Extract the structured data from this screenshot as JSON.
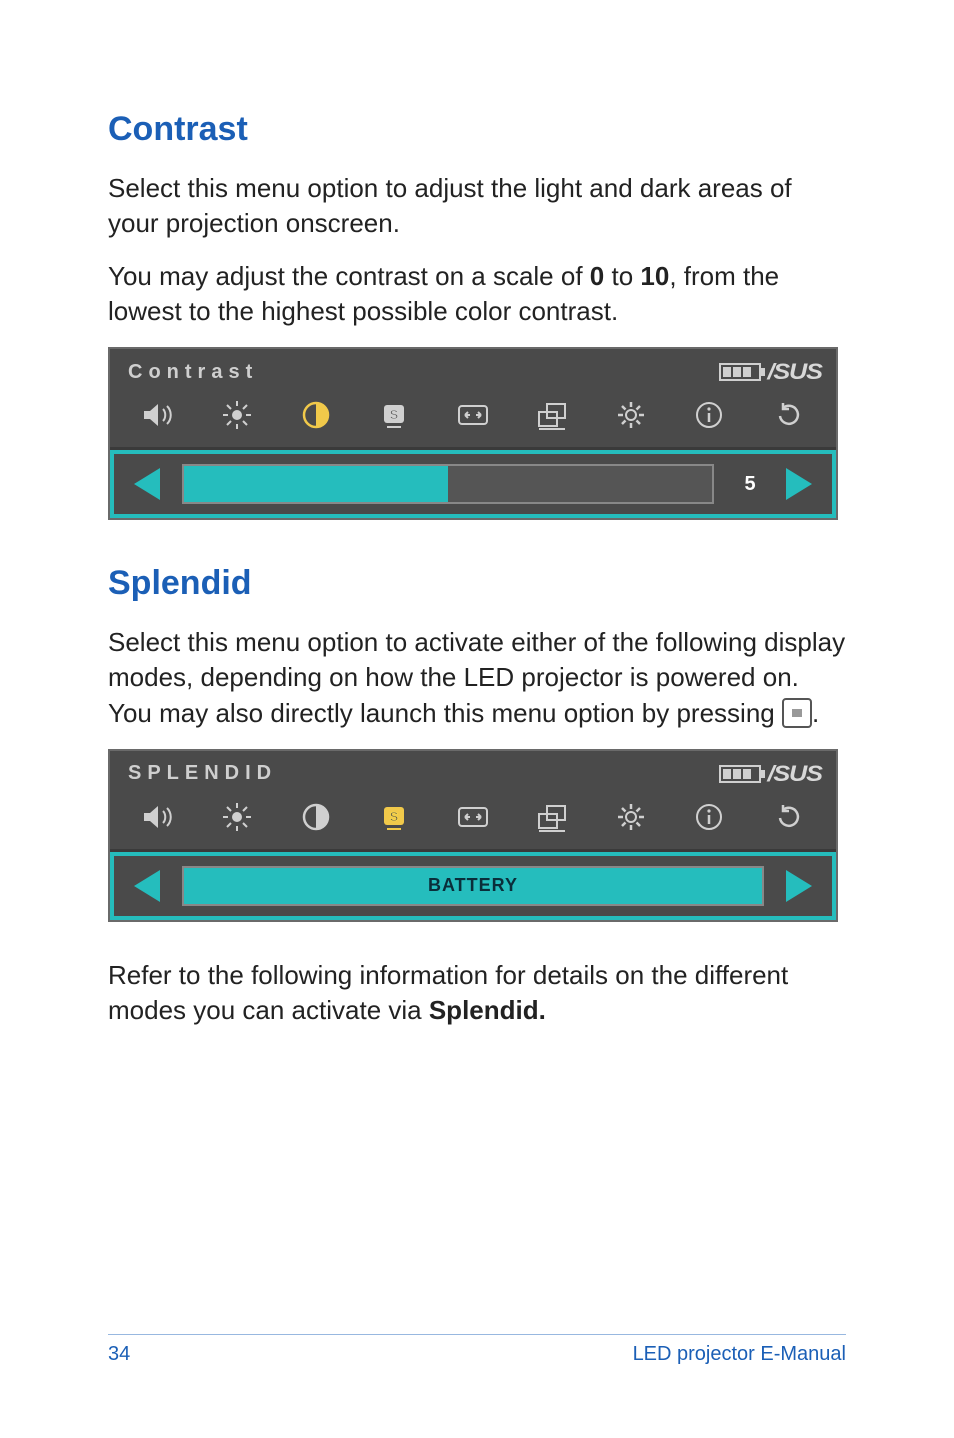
{
  "sections": {
    "contrast": {
      "heading": "Contrast",
      "para1": "Select this menu option to adjust the light and dark areas of your projection onscreen.",
      "para2_pre": "You may adjust the contrast on a scale of ",
      "para2_min": "0",
      "para2_mid": " to ",
      "para2_max": "10",
      "para2_post": ", from the lowest to the highest possible color contrast."
    },
    "splendid": {
      "heading": "Splendid",
      "para1_pre": "Select this menu option to activate either of the following display modes, depending on how the LED projector is powered on. You may also directly launch this menu option by pressing ",
      "para1_post": ".",
      "para2_pre": "Refer to the following information for details on the different modes you can activate via ",
      "para2_bold": "Splendid.",
      "para2_post": ""
    }
  },
  "osd": {
    "brand": "/SUS",
    "contrast": {
      "title": "Contrast",
      "value": "5",
      "fill_percent": 50
    },
    "splendid": {
      "title": "SPLENDID",
      "mode": "BATTERY"
    },
    "icons": [
      "volume-icon",
      "brightness-icon",
      "contrast-icon",
      "splendid-icon",
      "aspect-icon",
      "position-icon",
      "settings-icon",
      "info-icon",
      "reset-icon"
    ]
  },
  "footer": {
    "page": "34",
    "title": "LED projector E-Manual"
  }
}
